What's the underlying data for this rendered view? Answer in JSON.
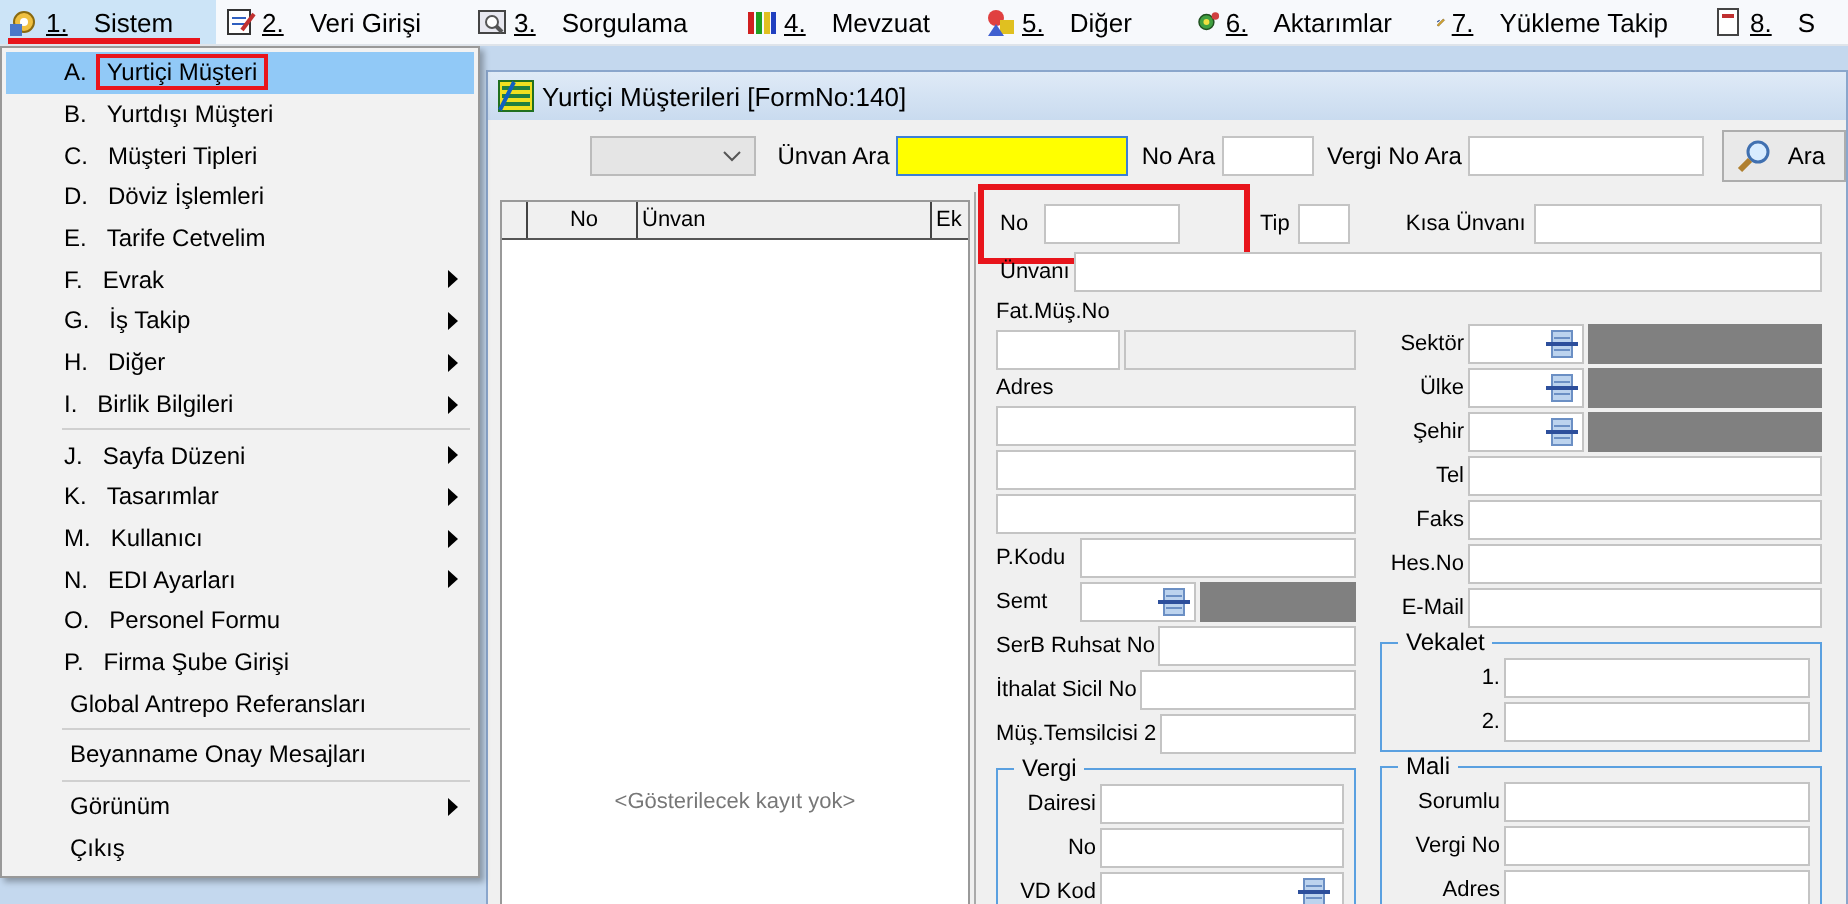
{
  "menubar": [
    {
      "number": "1.",
      "label": "Sistem",
      "selected": true,
      "highlighted": true
    },
    {
      "number": "2.",
      "label": "Veri Girişi",
      "selected": false,
      "highlighted": false
    },
    {
      "number": "3.",
      "label": "Sorgulama",
      "selected": false,
      "highlighted": false
    },
    {
      "number": "4.",
      "label": "Mevzuat",
      "selected": false,
      "highlighted": false
    },
    {
      "number": "5.",
      "label": "Diğer",
      "selected": false,
      "highlighted": false
    },
    {
      "number": "6.",
      "label": "Aktarımlar",
      "selected": false,
      "highlighted": false
    },
    {
      "number": "7.",
      "label": "Yükleme Takip",
      "selected": false,
      "highlighted": false
    },
    {
      "number": "8.",
      "label": "S",
      "selected": false,
      "highlighted": false
    }
  ],
  "menu": {
    "items": [
      {
        "kind": "item",
        "key": "A.",
        "label": "Yurtiçi Müşteri",
        "selected": true,
        "highlighted": true,
        "submenu": false
      },
      {
        "kind": "item",
        "key": "B.",
        "label": "Yurtdışı Müşteri",
        "selected": false,
        "highlighted": false,
        "submenu": false
      },
      {
        "kind": "item",
        "key": "C.",
        "label": "Müşteri Tipleri",
        "selected": false,
        "highlighted": false,
        "submenu": false
      },
      {
        "kind": "item",
        "key": "D.",
        "label": "Döviz İşlemleri",
        "selected": false,
        "highlighted": false,
        "submenu": false
      },
      {
        "kind": "item",
        "key": "E.",
        "label": "Tarife Cetvelim",
        "selected": false,
        "highlighted": false,
        "submenu": false
      },
      {
        "kind": "item",
        "key": "F.",
        "label": "Evrak",
        "selected": false,
        "highlighted": false,
        "submenu": true
      },
      {
        "kind": "item",
        "key": "G.",
        "label": "İş Takip",
        "selected": false,
        "highlighted": false,
        "submenu": true
      },
      {
        "kind": "item",
        "key": "H.",
        "label": "Diğer",
        "selected": false,
        "highlighted": false,
        "submenu": true
      },
      {
        "kind": "item",
        "key": "I.",
        "label": "Birlik Bilgileri",
        "selected": false,
        "highlighted": false,
        "submenu": true
      },
      {
        "kind": "separator"
      },
      {
        "kind": "item",
        "key": "J.",
        "label": "Sayfa Düzeni",
        "selected": false,
        "highlighted": false,
        "submenu": true
      },
      {
        "kind": "item",
        "key": "K.",
        "label": "Tasarımlar",
        "selected": false,
        "highlighted": false,
        "submenu": true
      },
      {
        "kind": "item",
        "key": "M.",
        "label": "Kullanıcı",
        "selected": false,
        "highlighted": false,
        "submenu": true
      },
      {
        "kind": "item",
        "key": "N.",
        "label": "EDI Ayarları",
        "selected": false,
        "highlighted": false,
        "submenu": true
      },
      {
        "kind": "item",
        "key": "O.",
        "label": "Personel Formu",
        "selected": false,
        "highlighted": false,
        "submenu": false
      },
      {
        "kind": "item",
        "key": "P.",
        "label": "Firma Şube Girişi",
        "selected": false,
        "highlighted": false,
        "submenu": false
      },
      {
        "kind": "item",
        "label": "Global Antrepo Referansları",
        "selected": false,
        "highlighted": false,
        "submenu": false
      },
      {
        "kind": "separator"
      },
      {
        "kind": "item",
        "label": "Beyanname Onay Mesajları",
        "selected": false,
        "highlighted": false,
        "submenu": false
      },
      {
        "kind": "separator"
      },
      {
        "kind": "item",
        "label": "Görünüm",
        "selected": false,
        "highlighted": false,
        "submenu": true
      },
      {
        "kind": "item",
        "label": "Çıkış",
        "selected": false,
        "highlighted": false,
        "submenu": false
      }
    ]
  },
  "window": {
    "title": "Yurtiçi Müşterileri [FormNo:140]"
  },
  "toolbar": {
    "filter_combo": {
      "disabled": true
    },
    "title_search": {
      "label": "Ünvan Ara",
      "focused": true
    },
    "no_search": {
      "label": "No Ara",
      "focused": false
    },
    "tax_search": {
      "label": "Vergi No Ara",
      "focused": false
    },
    "search_button": "Ara"
  },
  "grid": {
    "columns": [
      "No",
      "Ünvan",
      "Ek"
    ],
    "empty_text": "<Gösterilecek kayıt yok>"
  },
  "form": {
    "no": {
      "label": "No",
      "highlighted": true
    },
    "tip": "Tip",
    "short_title": "Kısa Ünvanı",
    "title": "Ünvanı",
    "left": [
      {
        "kind": "caption",
        "label": "Fat.Müş.No"
      },
      {
        "kind": "pair"
      },
      {
        "kind": "caption",
        "label": "Adres"
      },
      {
        "kind": "field"
      },
      {
        "kind": "field"
      },
      {
        "kind": "field"
      },
      {
        "kind": "labeled",
        "label": "P.Kodu"
      },
      {
        "kind": "lookup",
        "label": "Semt"
      },
      {
        "kind": "labeled",
        "label": "SerB Ruhsat No"
      },
      {
        "kind": "labeled",
        "label": "İthalat Sicil No"
      },
      {
        "kind": "labeled",
        "label": "Müş.Temsilcisi 2"
      },
      {
        "kind": "group",
        "title": "Vergi",
        "rows": [
          {
            "kind": "labeled",
            "label": "Dairesi"
          },
          {
            "kind": "labeled",
            "label": "No"
          },
          {
            "kind": "code",
            "label": "VD Kod"
          }
        ]
      }
    ],
    "right": [
      {
        "kind": "lookup",
        "label": "Sektör"
      },
      {
        "kind": "lookup",
        "label": "Ülke"
      },
      {
        "kind": "lookup",
        "label": "Şehir"
      },
      {
        "kind": "labeled",
        "label": "Tel"
      },
      {
        "kind": "labeled",
        "label": "Faks"
      },
      {
        "kind": "labeled",
        "label": "Hes.No"
      },
      {
        "kind": "labeled",
        "label": "E-Mail"
      },
      {
        "kind": "group",
        "title": "Vekalet",
        "rows": [
          {
            "kind": "labeled",
            "label": "1."
          },
          {
            "kind": "labeled",
            "label": "2."
          }
        ]
      },
      {
        "kind": "group",
        "title": "Mali",
        "rows": [
          {
            "kind": "labeled",
            "label": "Sorumlu"
          },
          {
            "kind": "labeled",
            "label": "Vergi No"
          },
          {
            "kind": "labeled",
            "label": "Adres"
          }
        ]
      }
    ]
  }
}
